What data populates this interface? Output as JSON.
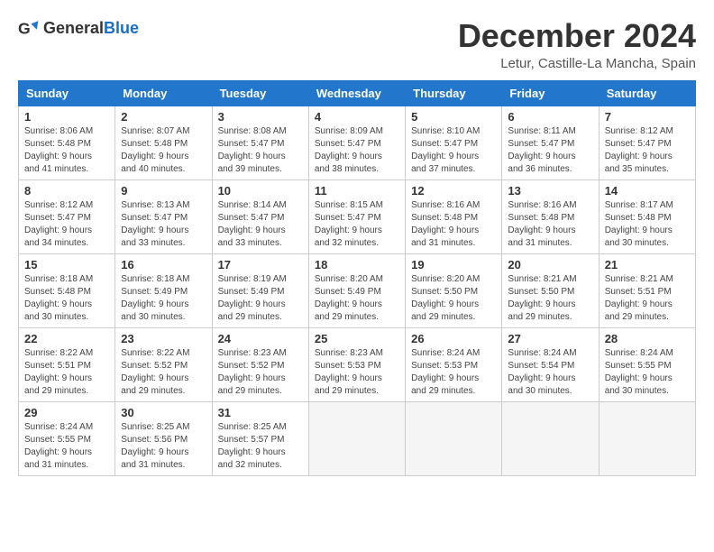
{
  "header": {
    "logo_general": "General",
    "logo_blue": "Blue",
    "month_title": "December 2024",
    "location": "Letur, Castille-La Mancha, Spain"
  },
  "weekdays": [
    "Sunday",
    "Monday",
    "Tuesday",
    "Wednesday",
    "Thursday",
    "Friday",
    "Saturday"
  ],
  "weeks": [
    [
      {
        "day": "1",
        "sunrise": "8:06 AM",
        "sunset": "5:48 PM",
        "daylight": "9 hours and 41 minutes."
      },
      {
        "day": "2",
        "sunrise": "8:07 AM",
        "sunset": "5:48 PM",
        "daylight": "9 hours and 40 minutes."
      },
      {
        "day": "3",
        "sunrise": "8:08 AM",
        "sunset": "5:47 PM",
        "daylight": "9 hours and 39 minutes."
      },
      {
        "day": "4",
        "sunrise": "8:09 AM",
        "sunset": "5:47 PM",
        "daylight": "9 hours and 38 minutes."
      },
      {
        "day": "5",
        "sunrise": "8:10 AM",
        "sunset": "5:47 PM",
        "daylight": "9 hours and 37 minutes."
      },
      {
        "day": "6",
        "sunrise": "8:11 AM",
        "sunset": "5:47 PM",
        "daylight": "9 hours and 36 minutes."
      },
      {
        "day": "7",
        "sunrise": "8:12 AM",
        "sunset": "5:47 PM",
        "daylight": "9 hours and 35 minutes."
      }
    ],
    [
      {
        "day": "8",
        "sunrise": "8:12 AM",
        "sunset": "5:47 PM",
        "daylight": "9 hours and 34 minutes."
      },
      {
        "day": "9",
        "sunrise": "8:13 AM",
        "sunset": "5:47 PM",
        "daylight": "9 hours and 33 minutes."
      },
      {
        "day": "10",
        "sunrise": "8:14 AM",
        "sunset": "5:47 PM",
        "daylight": "9 hours and 33 minutes."
      },
      {
        "day": "11",
        "sunrise": "8:15 AM",
        "sunset": "5:47 PM",
        "daylight": "9 hours and 32 minutes."
      },
      {
        "day": "12",
        "sunrise": "8:16 AM",
        "sunset": "5:48 PM",
        "daylight": "9 hours and 31 minutes."
      },
      {
        "day": "13",
        "sunrise": "8:16 AM",
        "sunset": "5:48 PM",
        "daylight": "9 hours and 31 minutes."
      },
      {
        "day": "14",
        "sunrise": "8:17 AM",
        "sunset": "5:48 PM",
        "daylight": "9 hours and 30 minutes."
      }
    ],
    [
      {
        "day": "15",
        "sunrise": "8:18 AM",
        "sunset": "5:48 PM",
        "daylight": "9 hours and 30 minutes."
      },
      {
        "day": "16",
        "sunrise": "8:18 AM",
        "sunset": "5:49 PM",
        "daylight": "9 hours and 30 minutes."
      },
      {
        "day": "17",
        "sunrise": "8:19 AM",
        "sunset": "5:49 PM",
        "daylight": "9 hours and 29 minutes."
      },
      {
        "day": "18",
        "sunrise": "8:20 AM",
        "sunset": "5:49 PM",
        "daylight": "9 hours and 29 minutes."
      },
      {
        "day": "19",
        "sunrise": "8:20 AM",
        "sunset": "5:50 PM",
        "daylight": "9 hours and 29 minutes."
      },
      {
        "day": "20",
        "sunrise": "8:21 AM",
        "sunset": "5:50 PM",
        "daylight": "9 hours and 29 minutes."
      },
      {
        "day": "21",
        "sunrise": "8:21 AM",
        "sunset": "5:51 PM",
        "daylight": "9 hours and 29 minutes."
      }
    ],
    [
      {
        "day": "22",
        "sunrise": "8:22 AM",
        "sunset": "5:51 PM",
        "daylight": "9 hours and 29 minutes."
      },
      {
        "day": "23",
        "sunrise": "8:22 AM",
        "sunset": "5:52 PM",
        "daylight": "9 hours and 29 minutes."
      },
      {
        "day": "24",
        "sunrise": "8:23 AM",
        "sunset": "5:52 PM",
        "daylight": "9 hours and 29 minutes."
      },
      {
        "day": "25",
        "sunrise": "8:23 AM",
        "sunset": "5:53 PM",
        "daylight": "9 hours and 29 minutes."
      },
      {
        "day": "26",
        "sunrise": "8:24 AM",
        "sunset": "5:53 PM",
        "daylight": "9 hours and 29 minutes."
      },
      {
        "day": "27",
        "sunrise": "8:24 AM",
        "sunset": "5:54 PM",
        "daylight": "9 hours and 30 minutes."
      },
      {
        "day": "28",
        "sunrise": "8:24 AM",
        "sunset": "5:55 PM",
        "daylight": "9 hours and 30 minutes."
      }
    ],
    [
      {
        "day": "29",
        "sunrise": "8:24 AM",
        "sunset": "5:55 PM",
        "daylight": "9 hours and 31 minutes."
      },
      {
        "day": "30",
        "sunrise": "8:25 AM",
        "sunset": "5:56 PM",
        "daylight": "9 hours and 31 minutes."
      },
      {
        "day": "31",
        "sunrise": "8:25 AM",
        "sunset": "5:57 PM",
        "daylight": "9 hours and 32 minutes."
      },
      null,
      null,
      null,
      null
    ]
  ]
}
